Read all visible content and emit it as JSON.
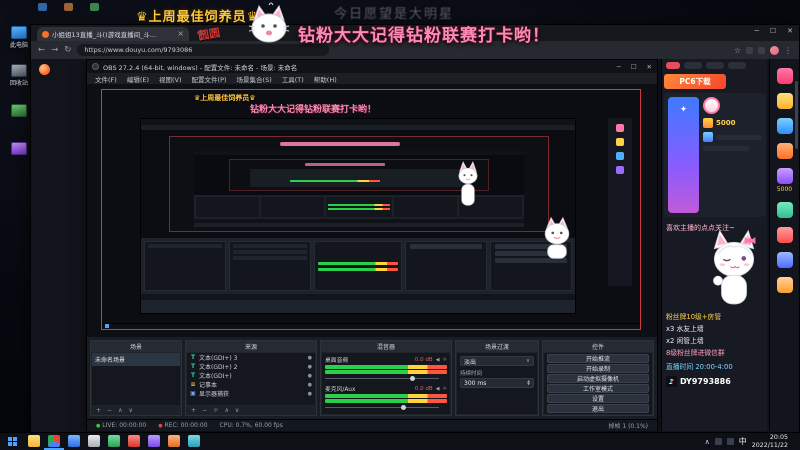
{
  "colors": {
    "accent_orange": "#ff6e26",
    "banner_gold": "#ffc83d",
    "banner_pink": "#ff8ab3",
    "meter_green": "#2bd04a",
    "live_green": "#35c94a",
    "rec_red": "#d9483b",
    "points_yellow": "#ffd24a"
  },
  "icons": {
    "crown": "♛",
    "dot": "●",
    "eye": "●",
    "plus": "+",
    "minus": "−",
    "up_arrow": "∧",
    "down_arrow": "∨",
    "settings": "☼",
    "dropdown": "∨",
    "spin_up": "▲",
    "spin_down": "▼",
    "back": "←",
    "forward": "→",
    "reload": "↻",
    "bookmark": "☆",
    "overflow_menu": "⋮",
    "speaker": "◀",
    "note": "♪",
    "star": "✦",
    "tab_close": "×",
    "window_min": "─",
    "window_max": "☐",
    "window_close": "✕",
    "new_tab": "+"
  },
  "overlay": {
    "gold_banner": "上周最佳饲养员",
    "faint_banner": "今日愿望是大明星",
    "pink_banner": "钻粉大大记得钻粉联赛打卡哟！",
    "stamp_text": "圆圆"
  },
  "desktop_icons": [
    {
      "label": "此电脑"
    },
    {
      "label": "回收站"
    }
  ],
  "browser": {
    "tab_title": "小姐姐13直播_斗()游戏直播间_斗...",
    "url": "https://www.douyu.com/9793086"
  },
  "obs": {
    "title": "OBS 27.2.4 (64-bit, windows) - 配置文件: 未命名 - 场景: 未命名",
    "menus": [
      "文件(F)",
      "编辑(E)",
      "视图(V)",
      "配置文件(P)",
      "场景集合(S)",
      "工具(T)",
      "帮助(H)"
    ],
    "scenes": {
      "title": "场景",
      "items": [
        "未命名场景"
      ]
    },
    "sources": {
      "title": "来源",
      "items": [
        {
          "icon": "T",
          "label": "文本(GDI+) 3"
        },
        {
          "icon": "T",
          "label": "文本(GDI+) 2"
        },
        {
          "icon": "T",
          "label": "文本(GDI+)"
        },
        {
          "icon": "≡",
          "label": "记事本"
        },
        {
          "icon": "▣",
          "label": "显示器捕获"
        }
      ]
    },
    "mixer": {
      "title": "混音器",
      "channels": [
        {
          "name": "桌面音频",
          "db": "0.0 dB"
        },
        {
          "name": "麦克风/Aux",
          "db": "0.0 dB"
        }
      ]
    },
    "transitions": {
      "title": "场景过渡",
      "selected": "淡出",
      "duration_label": "持续时间",
      "duration_value": "300 ms"
    },
    "controls": {
      "title": "控件",
      "buttons": [
        "开始推流",
        "开始录制",
        "启动虚拟摄像机",
        "工作室模式",
        "设置",
        "退出"
      ]
    },
    "status": {
      "live": "LIVE: 00:00:00",
      "rec": "REC: 00:00:00",
      "cpu": "CPU: 0.7%, 60.00 fps",
      "dropped": "掉帧 1 (0.1%)"
    }
  },
  "page": {
    "sidebar": {
      "ad_text": "PC6下载",
      "gift_points": [
        "5000",
        "5000"
      ],
      "notice": "喜欢主播的点点关注~",
      "rules": [
        "粉丝牌10级+房管",
        "x3 水友上墙",
        "x2 闲管上墙",
        "8级粉丝牌进微信群"
      ],
      "schedule": "直播时间 20:00-4:00",
      "douyin_id": "DY9793886"
    }
  },
  "taskbar": {
    "time": "20:05",
    "date": "2022/11/22",
    "ime": "中",
    "tray_caret": "∧"
  }
}
